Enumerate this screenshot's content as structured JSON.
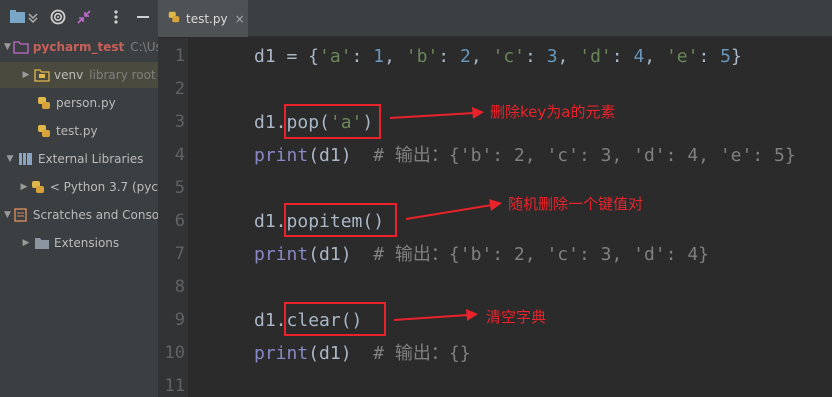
{
  "sidebar": {
    "toolbar_icons": [
      "project-view-icon",
      "collapse-icon",
      "target-icon",
      "shrink-icon",
      "more-icon",
      "minimize-icon"
    ],
    "items": [
      {
        "name": "pycharm_test",
        "path": "C:\\Us",
        "icon": "folder-icon"
      },
      {
        "name": "venv",
        "note": "library root",
        "icon": "folder-icon"
      },
      {
        "name": "person.py",
        "icon": "python-file-icon"
      },
      {
        "name": "test.py",
        "icon": "python-file-icon"
      },
      {
        "name": "External Libraries",
        "icon": "library-icon"
      },
      {
        "name": "< Python 3.7 (pyc",
        "icon": "python-icon"
      },
      {
        "name": "Scratches and Conso",
        "icon": "scratch-icon"
      },
      {
        "name": "Extensions",
        "icon": "folder-icon"
      }
    ]
  },
  "editor": {
    "tab": {
      "label": "test.py",
      "close": "×"
    },
    "line_numbers": [
      "1",
      "2",
      "3",
      "4",
      "5",
      "6",
      "7",
      "8",
      "9",
      "10",
      "11"
    ],
    "lines": {
      "l1": {
        "a": "d1 = {",
        "k1": "'a'",
        "c1": ": ",
        "v1": "1",
        "sep1": ", ",
        "k2": "'b'",
        "c2": ": ",
        "v2": "2",
        "sep2": ", ",
        "k3": "'c'",
        "c3": ": ",
        "v3": "3",
        "sep3": ", ",
        "k4": "'d'",
        "c4": ": ",
        "v4": "4",
        "sep4": ", ",
        "k5": "'e'",
        "c5": ": ",
        "v5": "5",
        "end": "}"
      },
      "l3": {
        "obj": "d1.",
        "call": "pop(",
        "arg": "'a'",
        "close": ")"
      },
      "l4": {
        "fn": "print",
        "args": "(d1)",
        "comment": "# 输出：{'b': 2, 'c': 3, 'd': 4, 'e': 5}"
      },
      "l6": {
        "obj": "d1.",
        "call": "popitem()"
      },
      "l7": {
        "fn": "print",
        "args": "(d1)",
        "comment": "# 输出：{'b': 2, 'c': 3, 'd': 4}"
      },
      "l9": {
        "obj": "d1.",
        "call": "clear()"
      },
      "l10": {
        "fn": "print",
        "args": "(d1)",
        "comment": "# 输出：{}"
      }
    }
  },
  "annotations": [
    "删除key为a的元素",
    "随机删除一个键值对",
    "清空字典"
  ],
  "colors": {
    "annotation": "#e8232b",
    "string": "#6a8759",
    "number": "#6897bb",
    "comment": "#808080",
    "builtin": "#8888c6"
  }
}
